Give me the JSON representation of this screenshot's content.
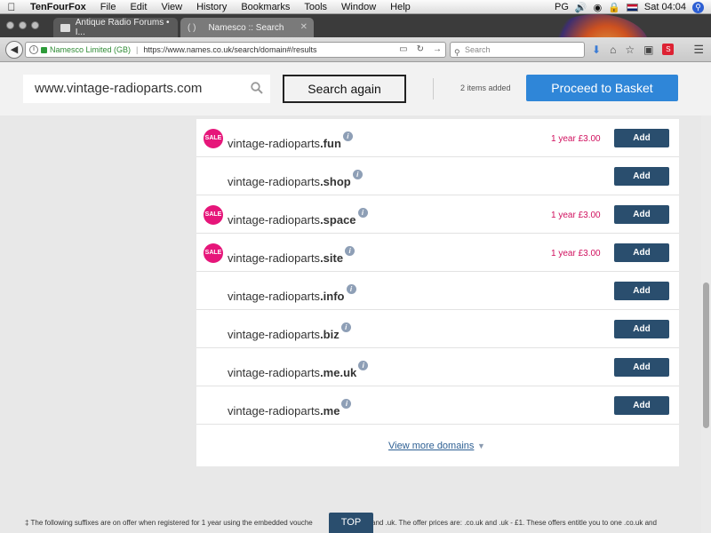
{
  "menubar": {
    "app": "TenFourFox",
    "items": [
      "File",
      "Edit",
      "View",
      "History",
      "Bookmarks",
      "Tools",
      "Window",
      "Help"
    ],
    "status_pg": "PG",
    "clock": "Sat 04:04"
  },
  "browser": {
    "tabs": [
      {
        "label": "Antique Radio Forums • I..."
      },
      {
        "label": "Namesco :: Search"
      }
    ],
    "url_org": "Namesco Limited (GB)",
    "url": "https://www.names.co.uk/search/domain#/results",
    "search_placeholder": "Search"
  },
  "header": {
    "query": "www.vintage-radioparts.com",
    "search_again": "Search again",
    "items_added": "2 items added",
    "proceed": "Proceed to Basket"
  },
  "results": {
    "base": "vintage-radioparts",
    "rows": [
      {
        "tld": ".fun",
        "sale": true,
        "price": "1 year £3.00"
      },
      {
        "tld": ".shop",
        "sale": false,
        "price": ""
      },
      {
        "tld": ".space",
        "sale": true,
        "price": "1 year £3.00"
      },
      {
        "tld": ".site",
        "sale": true,
        "price": "1 year £3.00"
      },
      {
        "tld": ".info",
        "sale": false,
        "price": ""
      },
      {
        "tld": ".biz",
        "sale": false,
        "price": ""
      },
      {
        "tld": ".me.uk",
        "sale": false,
        "price": ""
      },
      {
        "tld": ".me",
        "sale": false,
        "price": ""
      }
    ],
    "sale_label": "SALE",
    "add_label": "Add",
    "view_more": "View more domains"
  },
  "footer": {
    "note": "‡ The following suffixes are on offer when registered for 1 year using the embedded vouche",
    "note_tail": "k and .uk. The offer prices are: .co.uk and .uk - £1. These offers entitle you to one .co.uk and",
    "top": "TOP"
  }
}
